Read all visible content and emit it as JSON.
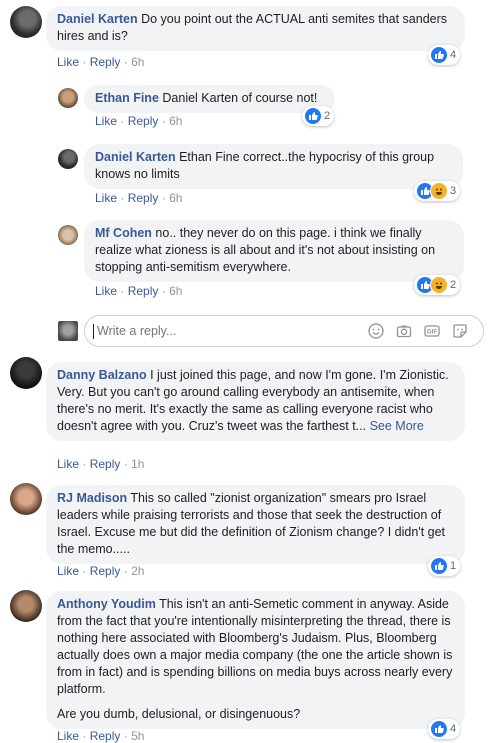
{
  "labels": {
    "like": "Like",
    "reply": "Reply",
    "sep": "·",
    "see_more": "See More"
  },
  "comments": [
    {
      "author": "Daniel Karten",
      "text": "Do you point out the ACTUAL anti semites that sanders hires and is?",
      "time": "6h",
      "reactions": "4"
    },
    {
      "author": "Ethan Fine",
      "text": "Daniel Karten of course not!",
      "time": "6h",
      "reactions": "2"
    },
    {
      "author": "Daniel Karten",
      "text": "Ethan Fine correct..the hypocrisy of this group knows no limits",
      "time": "6h",
      "reactions": "3"
    },
    {
      "author": "Mf Cohen",
      "text": "no.. they never do on this page. i think we finally realize what zioness is all about and it's not about insisting on stopping anti-semitism everywhere.",
      "time": "6h",
      "reactions": "2"
    },
    {
      "author": "Danny Balzano",
      "text": "I just joined this page, and now I'm gone. I'm Zionistic. Very. But you can't go around calling everybody an antisemite, when there's no merit. It's exactly the same as calling everyone racist who doesn't agree with you. Cruz's tweet was the farthest t...",
      "time": "1h"
    },
    {
      "author": "RJ Madison",
      "text": "This so called \"zionist organization\" smears pro Israel leaders while praising terrorists and those that seek the destruction of Israel. Excuse me but did the definition of Zionism change? I didn't get the memo.....",
      "time": "2h",
      "reactions": "1"
    },
    {
      "author": "Anthony Youdim",
      "text": "This isn't an anti-Semetic comment in anyway. Aside from the fact that you're intentionally misinterpreting the thread, there is nothing here associated with Bloomberg's Judaism. Plus, Bloomberg actually does own a major media company (the one the article shown is from in fact) and is spending billions on media buys across nearly every platform.",
      "text2": "Are you dumb, delusional, or disingenuous?",
      "time": "5h",
      "reactions": "4"
    }
  ],
  "reply_box": {
    "placeholder": "Write a reply...",
    "icons": [
      "emoji-icon",
      "camera-icon",
      "gif-icon",
      "sticker-icon"
    ]
  },
  "colors": {
    "link": "#385898",
    "bubble": "#f2f3f5",
    "like": "#2078f4",
    "haha": "#f7b125",
    "meta": "#90949c"
  }
}
